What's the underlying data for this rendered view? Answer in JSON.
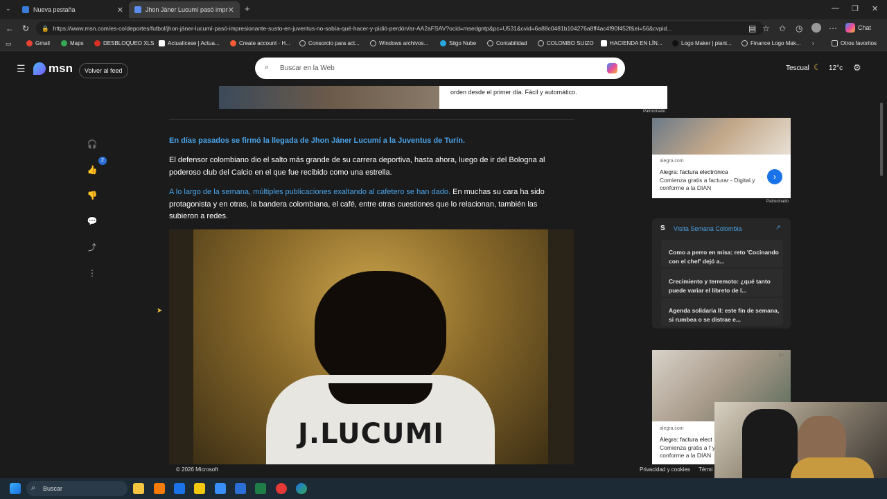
{
  "browser": {
    "tabs": [
      {
        "title": "Nueva pestaña",
        "active": false
      },
      {
        "title": "Jhon Jáner Lucumí pasó impresion",
        "active": true
      }
    ],
    "url": "https://www.msn.com/es-co/deportes/futbol/jhon-jáner-lucumí-pasó-impresionante-susto-en-juventus-no-sabía-qué-hacer-y-pidió-perdón/ar-AA2aFSAV?ocid=msedgntp&pc=U531&cvid=6a88c0481b104276a8ff4ac4f90f452f&ei=56&cvpid...",
    "chat_label": "Chat",
    "bookmarks": [
      "Gmail",
      "Maps",
      "DESBLOQUEO XLS",
      "Actualícese | Actua...",
      "Create account · H...",
      "Consorcio para act...",
      "Windows archivos...",
      "Siigo Nube",
      "Contabilidad",
      "COLOMBO SUIZO",
      "HACIENDA EN LÍN...",
      "Logo Maker | plant...",
      "Finance Logo Mak..."
    ],
    "other_favorites": "Otros favoritos"
  },
  "msn": {
    "logo": "msn",
    "back_to_feed": "Volver al feed",
    "search_placeholder": "Buscar en la Web",
    "weather_location": "Tescual",
    "weather_temp": "12°c"
  },
  "ad_top": {
    "text": "orden desde el primer día. Fácil y automático.",
    "sponsored": "Patrocinado"
  },
  "article": {
    "lead": "En días pasados se firmó la llegada de Jhon Jáner Lucumí a la Juventus de Turín.",
    "p1": "El defensor colombiano dio el salto más grande de su carrera deportiva, hasta ahora, luego de ir del Bologna al poderoso club del Calcio en el que fue recibido como una estrella.",
    "p2_link": "A lo largo de la semana, múltiples publicaciones exaltando al cafetero se han dado.",
    "p2_rest": "En muchas su cara ha sido protagonista y en otras, la bandera colombiana, el café, entre otras cuestiones que lo relacionan, también las subieron a redes.",
    "image_jersey_text": "J.LUCUMI",
    "like_count": "2"
  },
  "right_ad": {
    "domain": "alegra.com",
    "title": "Alegra: factura electrónica",
    "desc": "Comienza gratis a facturar - Digital y conforme a la DIAN",
    "sponsored": "Patrocinado"
  },
  "semana": {
    "header": "Visita Semana Colombia",
    "items": [
      "Como a perro en misa: reto 'Cocinando con el chef' dejó a...",
      "Crecimiento y terremoto: ¿qué tanto puede variar el libreto de l...",
      "Agenda solidaria II: este fin de semana, si rumbea o se distrae e..."
    ]
  },
  "right_ad2": {
    "domain": "alegra.com",
    "title": "Alegra: factura elect",
    "desc": "Comienza gratis a f y conforme a la DIAN"
  },
  "footer": {
    "copyright": "© 2026 Microsoft",
    "privacy": "Privacidad y cookies",
    "terms": "Térmi"
  },
  "taskbar": {
    "search": "Buscar"
  }
}
